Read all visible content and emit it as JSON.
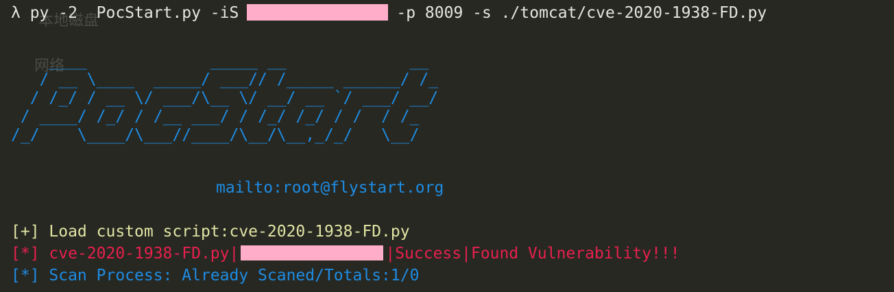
{
  "terminal": {
    "background": "#272822",
    "colors": {
      "default": "#e6e6e0",
      "banner": "#1e8ce3",
      "info": "#e1e5a4",
      "alert": "#e8204e",
      "redaction": "#ffadc9"
    },
    "command": {
      "prompt": "λ",
      "before_redaction": " py -2  PocStart.py -iS",
      "after_redaction": "-p 8009 -s ./tomcat/cve-2020-1938-FD.py"
    },
    "background_ghost_text": [
      "本地磁盘",
      "网络"
    ],
    "banner": {
      "ascii_lines": [
        "    ____             _____ __             __ ",
        "   / __ \\____  _____/ ___// /_____ ______/ /_",
        "  / /_/ / __ \\/ ___/\\__ \\/ __/ __ `/ ___/ __/",
        " / ____/ /_/ / /__ ___/ / /_/ /_/ / /  / /_  ",
        "/_/    \\____/\\___//____/\\__/\\__,_/_/   \\__/  "
      ],
      "mailto": "mailto:root@flystart.org"
    },
    "output": {
      "load": "[+] Load custom script:cve-2020-1938-FD.py",
      "found_prefix": "[*] cve-2020-1938-FD.py|",
      "found_suffix": "|Success|Found Vulnerability!!!",
      "scan": "[*] Scan Process: Already Scaned/Totals:1/0"
    }
  }
}
